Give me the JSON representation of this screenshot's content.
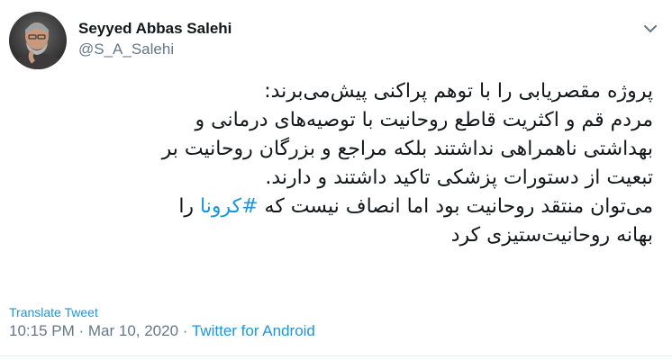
{
  "user": {
    "name": "Seyyed Abbas Salehi",
    "handle": "@S_A_Salehi",
    "avatar_icon": "profile-photo"
  },
  "tweet": {
    "lines": [
      "پروژه مقصریابی را با توهم پراکنی پیش‌می‌برند:",
      "مردم قم و اکثریت قاطع روحانیت با توصیه‌های درمانی و",
      "بهداشتی ناهمراهی نداشتند بلکه مراجع و بزرگان روحانیت بر",
      "تبعیت از دستورات پزشکی تاکید داشتند و دارند."
    ],
    "line5_before": "می‌توان منتقد روحانیت بود اما انصاف نیست که ",
    "hashtag": "#کرونا",
    "line5_after": " را",
    "line6": "بهانه روحانیت‌ستیزی کرد"
  },
  "translate_label": "Translate Tweet",
  "meta": {
    "time": "10:15 PM",
    "separator1": " · ",
    "date": "Mar 10, 2020",
    "separator2": " · ",
    "source": "Twitter for Android"
  },
  "colors": {
    "link": "#1b95e0",
    "secondary": "#657786",
    "text": "#14171a"
  },
  "icons": {
    "menu": "chevron-down-icon"
  }
}
